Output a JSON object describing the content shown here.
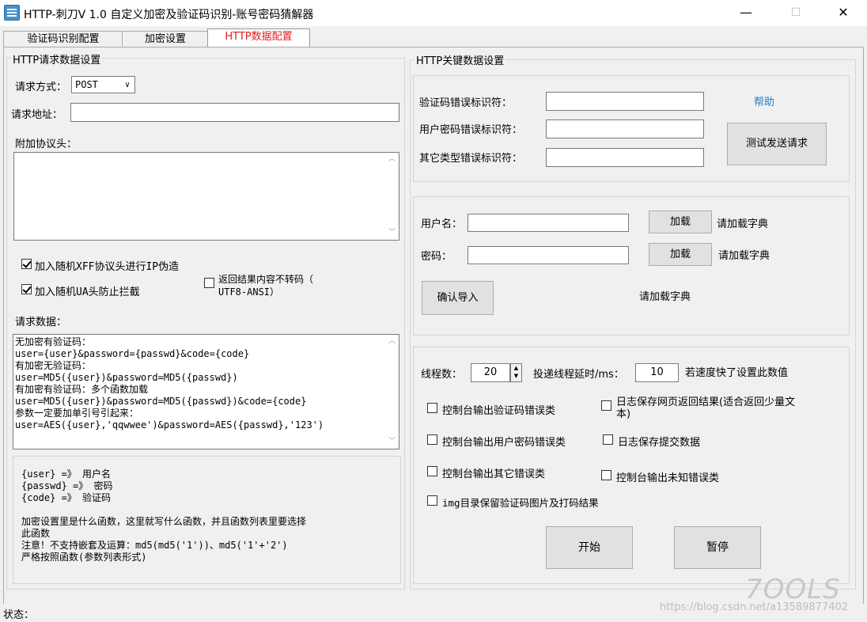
{
  "window": {
    "title": "HTTP-刺刀V 1.0  自定义加密及验证码识别-账号密码猜解器",
    "minimize": "—",
    "maximize": "☐",
    "close": "✕"
  },
  "tabs": [
    {
      "label": "验证码识别配置"
    },
    {
      "label": "加密设置"
    },
    {
      "label": "HTTP数据配置"
    }
  ],
  "left": {
    "group_title": "HTTP请求数据设置",
    "method_label": "请求方式：",
    "method_value": "POST",
    "url_label": "请求地址：",
    "url_value": "",
    "headers_label": "附加协议头：",
    "headers_value": "",
    "xff_label": "加入随机XFF协议头进行IP伪造",
    "ua_label": "加入随机UA头防止拦截",
    "noconv_label_1": "返回结果内容不转码（",
    "noconv_label_2": "UTF8-ANSI）",
    "request_data_label": "请求数据：",
    "request_lines": [
      "无加密有验证码：",
      "user={user}&password={passwd}&code={code}",
      "有加密无验证码：",
      "user=MD5({user})&password=MD5({passwd})",
      "有加密有验证码：多个函数加载",
      "user=MD5({user})&password=MD5({passwd})&code={code}",
      "参数一定要加单引号引起来：",
      "user=AES({user},'qqwwee')&password=AES({passwd},'123')"
    ],
    "help_lines": [
      "{user} =》 用户名",
      "{passwd} =》 密码",
      "{code} =》 验证码",
      "",
      "加密设置里是什么函数，这里就写什么函数，并且函数列表里要选择",
      "此函数",
      "注意！不支持嵌套及运算：md5(md5('1'))、md5('1'+'2')",
      "严格按照函数(参数列表形式)"
    ]
  },
  "right": {
    "group_title": "HTTP关键数据设置",
    "captcha_err_label": "验证码错误标识符：",
    "userpass_err_label": "用户密码错误标识符：",
    "other_err_label": "其它类型错误标识符：",
    "help_link": "帮助",
    "test_button": "测试发送请求",
    "username_label": "用户名：",
    "password_label": "密码：",
    "load_button": "加载",
    "load_hint": "请加载字典",
    "confirm_button": "确认导入",
    "dict_status": "请加载字典",
    "threads_label": "线程数：",
    "threads_value": "20",
    "delay_label": "投递线程延时/ms：",
    "delay_value": "10",
    "delay_hint": "若速度快了设置此数值",
    "opt_captcha": "控制台输出验证码错误类",
    "opt_userpass": "控制台输出用户密码错误类",
    "opt_other": "控制台输出其它错误类",
    "opt_img": "img目录保留验证码图片及打码结果",
    "opt_log_resp_1": "日志保存网页返回结果(适合返回少量文",
    "opt_log_resp_2": "本)",
    "opt_log_submit": "日志保存提交数据",
    "opt_unknown": "控制台输出未知错误类",
    "start_button": "开始",
    "pause_button": "暂停"
  },
  "status": {
    "label": "状态："
  },
  "watermark": {
    "logo": "7OOLS",
    "url": "https://blog.csdn.net/a13589877402"
  }
}
